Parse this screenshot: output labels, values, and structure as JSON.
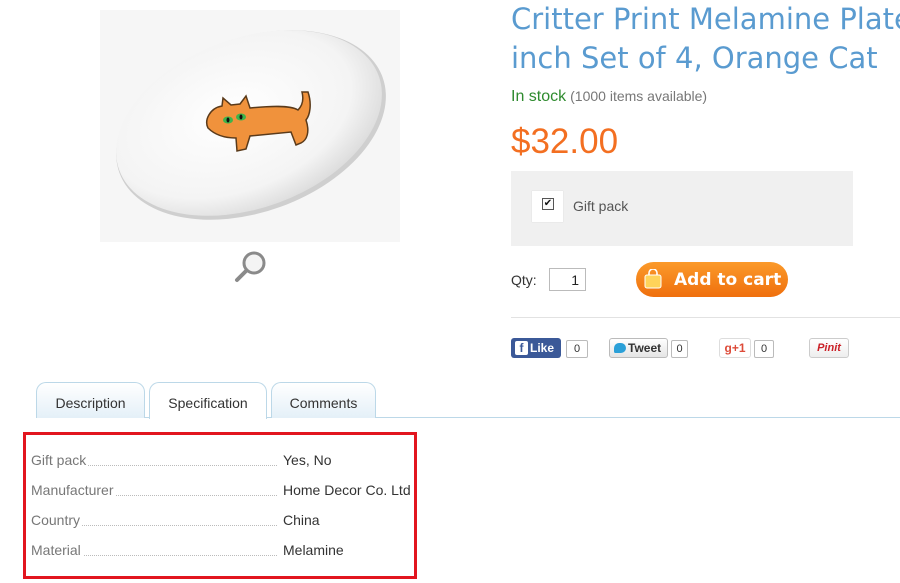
{
  "product": {
    "title_line1": "Critter Print Melamine Plate",
    "title_line2": "inch Set of 4, Orange Cat",
    "stock_status": "In stock",
    "stock_available": "(1000 items available)",
    "price": "$32.00"
  },
  "options": {
    "gift_pack_label": "Gift pack",
    "gift_pack_checked": true
  },
  "purchase": {
    "qty_label": "Qty:",
    "qty_value": "1",
    "add_to_cart_label": "Add to cart"
  },
  "social": {
    "facebook_label": "Like",
    "facebook_count": "0",
    "twitter_label": "Tweet",
    "twitter_count": "0",
    "gplus_label": "g+1",
    "gplus_count": "0",
    "pinterest_label": "Pinit"
  },
  "tabs": [
    {
      "label": "Description"
    },
    {
      "label": "Specification"
    },
    {
      "label": "Comments"
    }
  ],
  "active_tab": "Specification",
  "specification": [
    {
      "name": "Gift pack",
      "value": "Yes, No"
    },
    {
      "name": "Manufacturer",
      "value": "Home Decor Co. Ltd"
    },
    {
      "name": "Country",
      "value": "China"
    },
    {
      "name": "Material",
      "value": "Melamine"
    }
  ],
  "colors": {
    "title": "#5a9bd0",
    "in_stock": "#2e8b2e",
    "price": "#f36f21",
    "cart_button": "#f7861b",
    "highlight_border": "#e2151f"
  },
  "icons": {
    "zoom": "magnifier-icon",
    "cart": "shopping-bag-icon"
  }
}
